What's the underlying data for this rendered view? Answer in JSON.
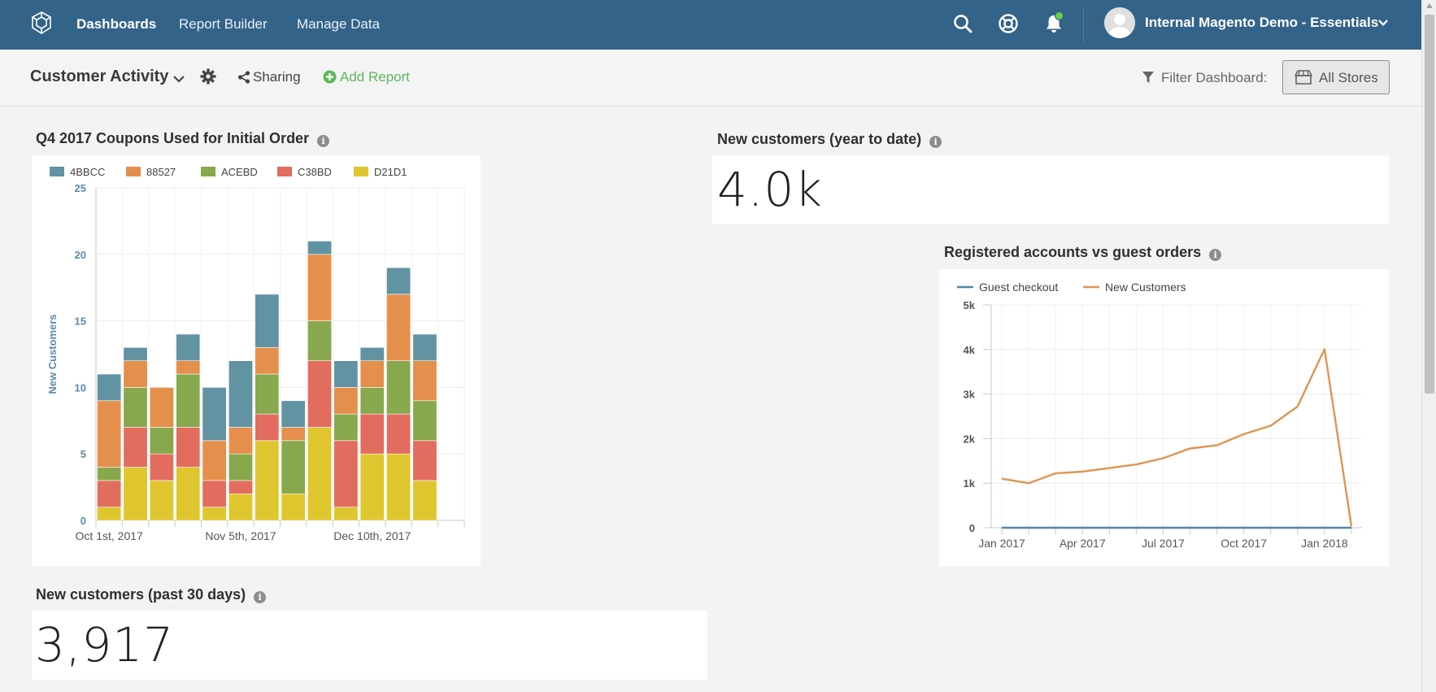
{
  "topbar": {
    "nav": [
      "Dashboards",
      "Report Builder",
      "Manage Data"
    ],
    "account": "Internal Magento Demo - Essentials",
    "icons": [
      "search-icon",
      "help-icon",
      "bell-icon"
    ],
    "bg_color": "#336389",
    "has_notification": true
  },
  "dashboard": {
    "title": "Customer Activity",
    "sharing_label": "Sharing",
    "add_report_label": "Add Report",
    "filter_label": "Filter Dashboard:",
    "stores_label": "All Stores"
  },
  "cards": {
    "coupons": {
      "title": "Q4 2017 Coupons Used for Initial Order"
    },
    "ytd": {
      "title": "New customers (year to date)",
      "value": "4.0k"
    },
    "registered": {
      "title": "Registered accounts vs guest orders"
    },
    "past30": {
      "title": "New customers (past 30 days)",
      "value": "3,917"
    }
  },
  "chart_data": [
    {
      "type": "bar",
      "stacked": true,
      "ylabel": "New Customers",
      "ylim": [
        0,
        25
      ],
      "yticks": [
        0,
        5,
        10,
        15,
        20,
        25
      ],
      "xtick_labels": [
        "Oct 1st, 2017",
        "Nov 5th, 2017",
        "Dec 10th, 2017"
      ],
      "xtick_label_index": [
        0,
        5,
        10
      ],
      "legend_position": "top",
      "grid": true,
      "categories": [
        "1",
        "2",
        "3",
        "4",
        "5",
        "6",
        "7",
        "8",
        "9",
        "10",
        "11",
        "12",
        "13",
        "14"
      ],
      "series": [
        {
          "name": "D21D1",
          "color": "#dfc62e",
          "values": [
            1,
            4,
            3,
            4,
            1,
            2,
            6,
            2,
            7,
            1,
            5,
            5,
            3,
            0
          ]
        },
        {
          "name": "C38BD",
          "color": "#e26c5e",
          "values": [
            2,
            3,
            2,
            3,
            2,
            1,
            2,
            0,
            5,
            5,
            3,
            3,
            3,
            0
          ]
        },
        {
          "name": "ACEBD",
          "color": "#88a84d",
          "values": [
            1,
            3,
            2,
            4,
            0,
            2,
            3,
            4,
            3,
            2,
            2,
            4,
            3,
            0
          ]
        },
        {
          "name": "88527",
          "color": "#e58f4c",
          "values": [
            5,
            2,
            3,
            1,
            3,
            2,
            2,
            1,
            5,
            2,
            2,
            5,
            3,
            0
          ]
        },
        {
          "name": "4BBCC",
          "color": "#6193a3",
          "values": [
            2,
            1,
            0,
            2,
            4,
            5,
            4,
            2,
            1,
            2,
            1,
            2,
            2,
            0
          ]
        }
      ],
      "legend_order": [
        "4BBCC",
        "88527",
        "ACEBD",
        "C38BD",
        "D21D1"
      ]
    },
    {
      "type": "line",
      "ylim": [
        0,
        5000
      ],
      "ytick_labels": [
        "0",
        "1k",
        "2k",
        "3k",
        "4k",
        "5k"
      ],
      "xtick_labels": [
        "Jan 2017",
        "Apr 2017",
        "Jul 2017",
        "Oct 2017",
        "Jan 2018"
      ],
      "legend_position": "top",
      "grid": true,
      "series": [
        {
          "name": "Guest checkout",
          "color": "#4f86ad",
          "values": [
            0,
            0,
            0,
            0,
            0,
            0,
            0,
            0,
            0,
            0,
            0,
            0,
            0,
            0
          ]
        },
        {
          "name": "New Customers",
          "color": "#de9551",
          "values": [
            1100,
            1000,
            1220,
            1260,
            1340,
            1420,
            1560,
            1780,
            1850,
            2100,
            2290,
            2720,
            4010,
            30
          ]
        }
      ],
      "x_months": [
        "Jan 2017",
        "Feb 2017",
        "Mar 2017",
        "Apr 2017",
        "May 2017",
        "Jun 2017",
        "Jul 2017",
        "Aug 2017",
        "Sep 2017",
        "Oct 2017",
        "Nov 2017",
        "Dec 2017",
        "Jan 2018",
        "Feb 2018"
      ]
    }
  ]
}
